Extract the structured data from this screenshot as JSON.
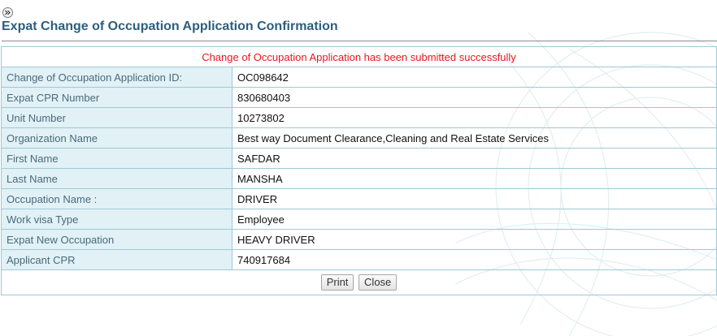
{
  "header": {
    "title": "Expat Change of Occupation Application Confirmation",
    "expand_icon": "double-chevron-right-icon"
  },
  "message": "Change of Occupation Application has been submitted successfully",
  "fields": [
    {
      "label": "Change of Occupation Application ID:",
      "value": "OC098642"
    },
    {
      "label": "Expat CPR Number",
      "value": "830680403"
    },
    {
      "label": "Unit Number",
      "value": "10273802"
    },
    {
      "label": "Organization Name",
      "value": "Best way Document Clearance,Cleaning and Real Estate Services"
    },
    {
      "label": "First Name",
      "value": "SAFDAR"
    },
    {
      "label": "Last Name",
      "value": "MANSHA"
    },
    {
      "label": "Occupation Name :",
      "value": "DRIVER"
    },
    {
      "label": "Work visa Type",
      "value": "Employee"
    },
    {
      "label": "Expat New Occupation",
      "value": "HEAVY DRIVER"
    },
    {
      "label": "Applicant CPR",
      "value": "740917684"
    }
  ],
  "actions": {
    "print_label": "Print",
    "close_label": "Close"
  },
  "colors": {
    "title": "#2d5f7d",
    "message": "#e8171f",
    "label_bg": "#dceef4",
    "border": "#9fc9d5"
  }
}
